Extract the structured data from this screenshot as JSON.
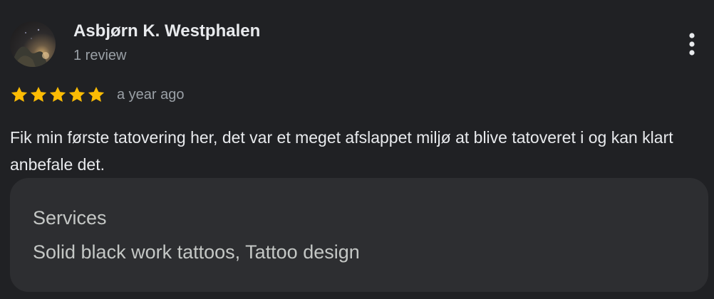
{
  "author": {
    "name": "Asbjørn K. Westphalen",
    "review_count": "1 review",
    "avatar_icon": "profile-photo-avatar"
  },
  "menu": {
    "icon": "more-vertical-icon"
  },
  "rating": {
    "stars": 5,
    "max_stars": 5,
    "star_color": "#fbbc04",
    "date": "a year ago"
  },
  "review": {
    "text": "Fik min første tatovering her, det var et meget afslappet miljø at blive tatoveret i og kan klart anbefale det."
  },
  "services": {
    "title": "Services",
    "value": "Solid black work tattoos, Tattoo design"
  },
  "colors": {
    "background": "#202124",
    "card": "#2d2e31",
    "primary_text": "#e8eaed",
    "secondary_text": "#9aa0a6"
  }
}
